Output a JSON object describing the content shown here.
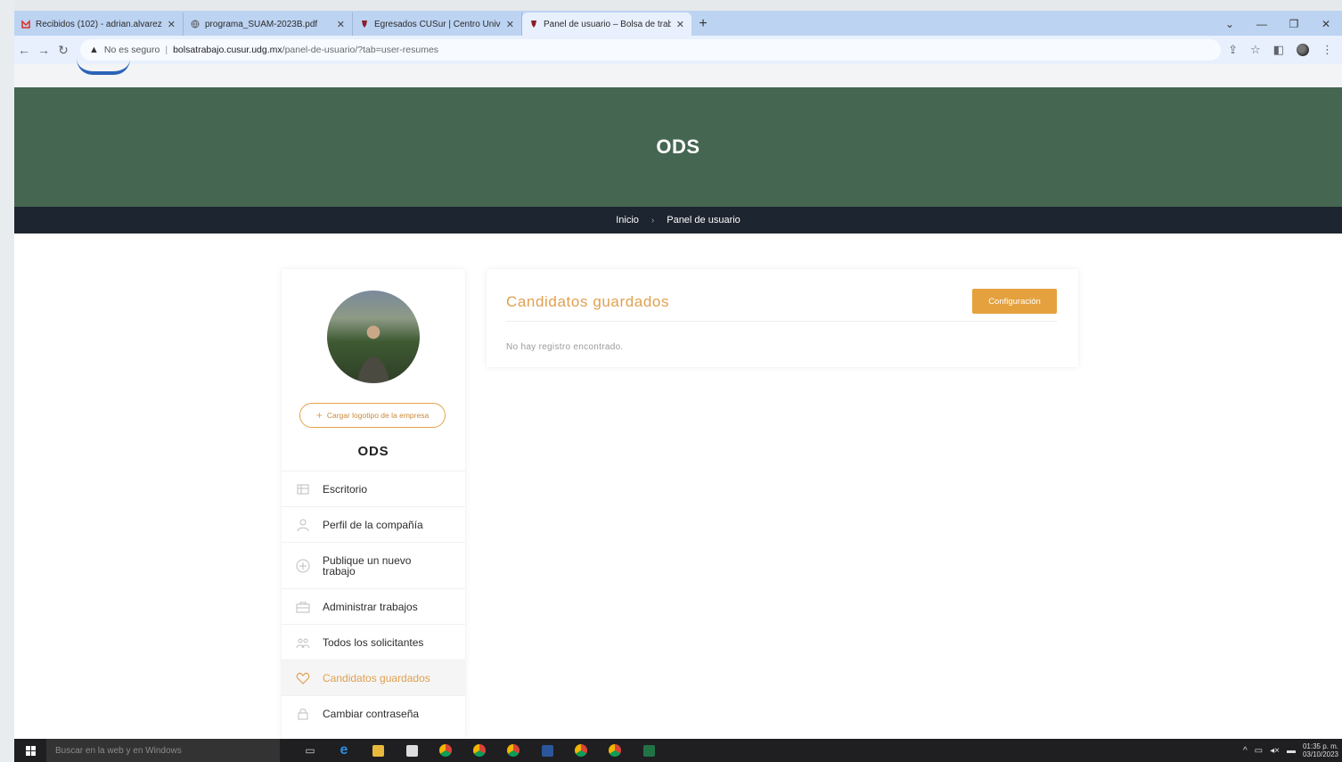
{
  "browser": {
    "tabs": [
      {
        "title": "Recibidos (102) - adrian.alvarez",
        "favicon": "gmail-icon",
        "color": "#d93025",
        "active": false
      },
      {
        "title": "programa_SUAM-2023B.pdf",
        "favicon": "globe-icon",
        "color": "#5f6368",
        "active": false
      },
      {
        "title": "Egresados CUSur | Centro Unive",
        "favicon": "udg-icon",
        "color": "#8a1f2a",
        "active": false
      },
      {
        "title": "Panel de usuario – Bolsa de trab",
        "favicon": "udg-icon",
        "color": "#8a1f2a",
        "active": true
      }
    ],
    "new_tab": "+",
    "address": {
      "security_label": "No es seguro",
      "domain": "bolsatrabajo.cusur.udg.mx",
      "path": "/panel-de-usuario/?tab=user-resumes"
    }
  },
  "hero": {
    "title": "ODS",
    "background": "#456651"
  },
  "breadcrumb": {
    "home": "Inicio",
    "separator": "›",
    "current": "Panel de usuario"
  },
  "sidebar": {
    "upload_label": "Cargar logotipo de la empresa",
    "company_name": "ODS",
    "items": [
      {
        "label": "Escritorio",
        "icon": "dashboard-icon",
        "active": false
      },
      {
        "label": "Perfil de la compañía",
        "icon": "user-icon",
        "active": false
      },
      {
        "label": "Publique un nuevo trabajo",
        "icon": "plus-circle-icon",
        "active": false
      },
      {
        "label": "Administrar trabajos",
        "icon": "briefcase-icon",
        "active": false
      },
      {
        "label": "Todos los solicitantes",
        "icon": "users-icon",
        "active": false
      },
      {
        "label": "Candidatos guardados",
        "icon": "heart-icon",
        "active": true
      },
      {
        "label": "Cambiar contraseña",
        "icon": "lock-icon",
        "active": false
      }
    ]
  },
  "panel": {
    "title": "Candidatos guardados",
    "config_button": "Configuración",
    "empty_message": "No hay registro encontrado."
  },
  "taskbar": {
    "search_placeholder": "Buscar en la web y en Windows",
    "time": "01:35 p. m.",
    "date": "03/10/2023"
  },
  "colors": {
    "accent": "#e5a13e",
    "breadcrumb_bg": "#1d2530"
  }
}
